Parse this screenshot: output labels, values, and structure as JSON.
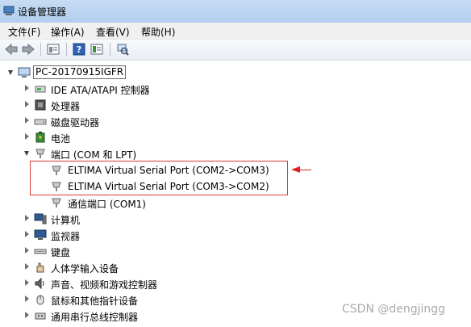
{
  "window": {
    "title": "设备管理器"
  },
  "menu": [
    "文件(F)",
    "操作(A)",
    "查看(V)",
    "帮助(H)"
  ],
  "toolbar": [
    "back-arrow-icon",
    "forward-arrow-icon",
    "properties-icon",
    "help-icon",
    "view-icon",
    "scan-hardware-icon"
  ],
  "tree": {
    "root": "PC-20170915IGFR",
    "items": [
      {
        "label": "IDE ATA/ATAPI 控制器",
        "icon": "ide-controller-icon"
      },
      {
        "label": "处理器",
        "icon": "processor-icon"
      },
      {
        "label": "磁盘驱动器",
        "icon": "disk-drive-icon"
      },
      {
        "label": "电池",
        "icon": "battery-icon"
      },
      {
        "label": "端口 (COM 和 LPT)",
        "icon": "port-icon",
        "expanded": true,
        "children": [
          {
            "label": "ELTIMA Virtual Serial Port (COM2->COM3)",
            "icon": "port-icon"
          },
          {
            "label": "ELTIMA Virtual Serial Port (COM3->COM2)",
            "icon": "port-icon"
          },
          {
            "label": "通信端口 (COM1)",
            "icon": "port-icon"
          }
        ]
      },
      {
        "label": "计算机",
        "icon": "computer-icon"
      },
      {
        "label": "监视器",
        "icon": "monitor-icon"
      },
      {
        "label": "键盘",
        "icon": "keyboard-icon"
      },
      {
        "label": "人体学输入设备",
        "icon": "hid-icon"
      },
      {
        "label": "声音、视频和游戏控制器",
        "icon": "sound-icon"
      },
      {
        "label": "鼠标和其他指针设备",
        "icon": "mouse-icon"
      },
      {
        "label": "通用串行总线控制器",
        "icon": "usb-icon"
      }
    ]
  },
  "watermark": "CSDN @dengjingg",
  "colors": {
    "highlight": "#d83a3a",
    "arrow": "#e02020",
    "titlebar": "#b9d1ea"
  }
}
